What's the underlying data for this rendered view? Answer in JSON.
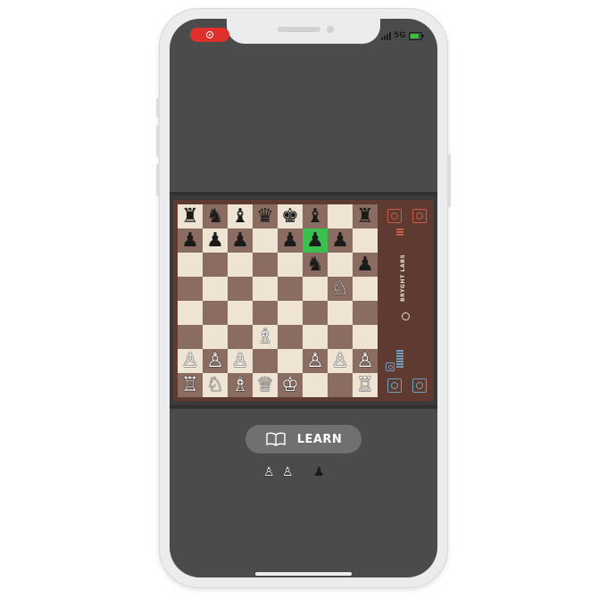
{
  "status_bar": {
    "network": "5G"
  },
  "board": {
    "rows": [
      [
        "♜",
        "♞",
        "♝",
        "♛",
        "♚",
        "♝",
        "",
        "♜"
      ],
      [
        "♟",
        "♟",
        "♟",
        "",
        "♟",
        "♟",
        "♟",
        ""
      ],
      [
        "",
        "",
        "",
        "",
        "",
        "♞",
        "",
        "♟"
      ],
      [
        "",
        "",
        "",
        "",
        "",
        "",
        "♘",
        ""
      ],
      [
        "",
        "",
        "",
        "",
        "",
        "",
        "",
        ""
      ],
      [
        "",
        "",
        "",
        "♗",
        "",
        "",
        "",
        ""
      ],
      [
        "♙",
        "♙",
        "♙",
        "",
        "",
        "♙",
        "♙",
        "♙"
      ],
      [
        "♖",
        "♘",
        "♗",
        "♕",
        "♔",
        "",
        "",
        "♖"
      ]
    ],
    "highlight": {
      "row": 1,
      "col": 5
    },
    "colors": {
      "light_square": "#efe4d4",
      "dark_square": "#8a6d60",
      "highlight": "#3bbf4f"
    }
  },
  "side_panel": {
    "brand": "BRYGHT LABS"
  },
  "learn_button": {
    "label": "LEARN",
    "icon": "open-book-icon"
  },
  "captured_pieces": {
    "white": [
      "♙",
      "♙"
    ],
    "black": [
      "♟"
    ]
  }
}
